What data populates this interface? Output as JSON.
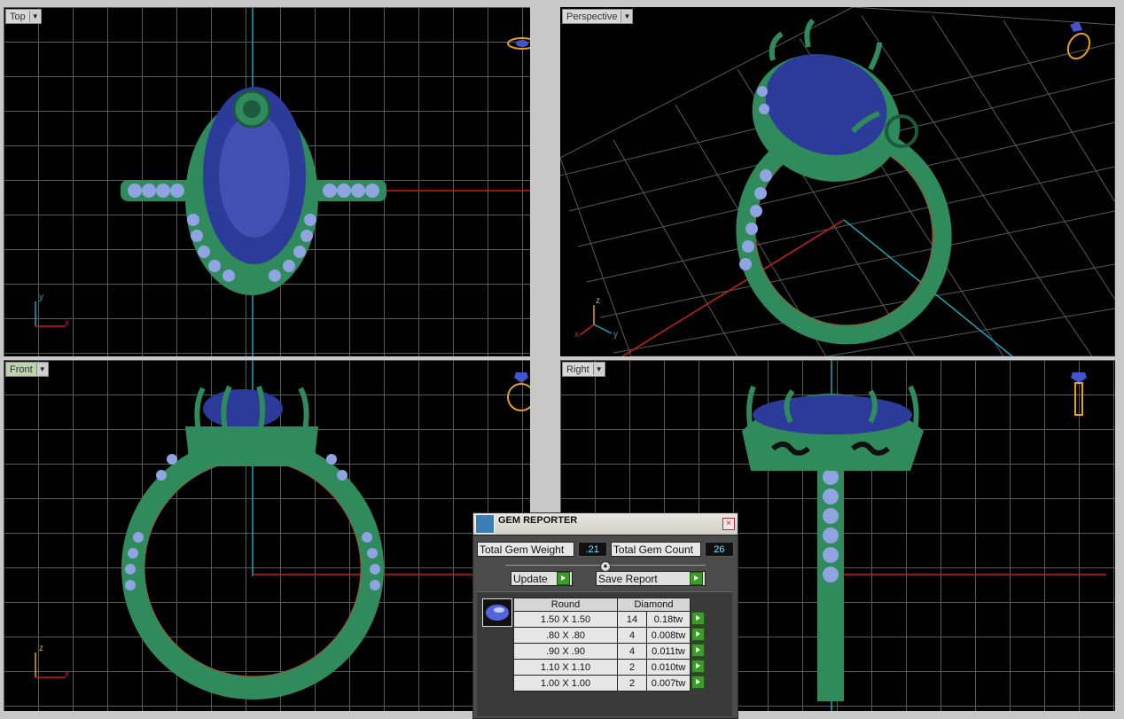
{
  "viewports": {
    "top": {
      "label": "Top",
      "axis_a": "y",
      "axis_b": "x"
    },
    "perspective": {
      "label": "Perspective",
      "axis_a": "z",
      "axis_b": "y",
      "axis_c": "x"
    },
    "front": {
      "label": "Front",
      "axis_a": "z",
      "axis_b": "x"
    },
    "right": {
      "label": "Right"
    }
  },
  "colors": {
    "metal": "#2f8a5c",
    "gem": "#3040a0",
    "accent_axis_x": "#c8201e",
    "accent_axis_y": "#1aa4b4"
  },
  "gem_reporter": {
    "title": "GEM REPORTER",
    "total_weight_label": "Total Gem Weight",
    "total_weight_value": ".21",
    "total_count_label": "Total Gem Count",
    "total_count_value": "26",
    "update_label": "Update",
    "save_label": "Save Report",
    "shape_header": "Round",
    "material_header": "Diamond",
    "rows": [
      {
        "size": "1.50 X 1.50",
        "count": "14",
        "weight": "0.18tw"
      },
      {
        "size": ".80 X .80",
        "count": "4",
        "weight": "0.008tw"
      },
      {
        "size": ".90 X .90",
        "count": "4",
        "weight": "0.011tw"
      },
      {
        "size": "1.10 X 1.10",
        "count": "2",
        "weight": "0.010tw"
      },
      {
        "size": "1.00 X 1.00",
        "count": "2",
        "weight": "0.007tw"
      }
    ]
  }
}
